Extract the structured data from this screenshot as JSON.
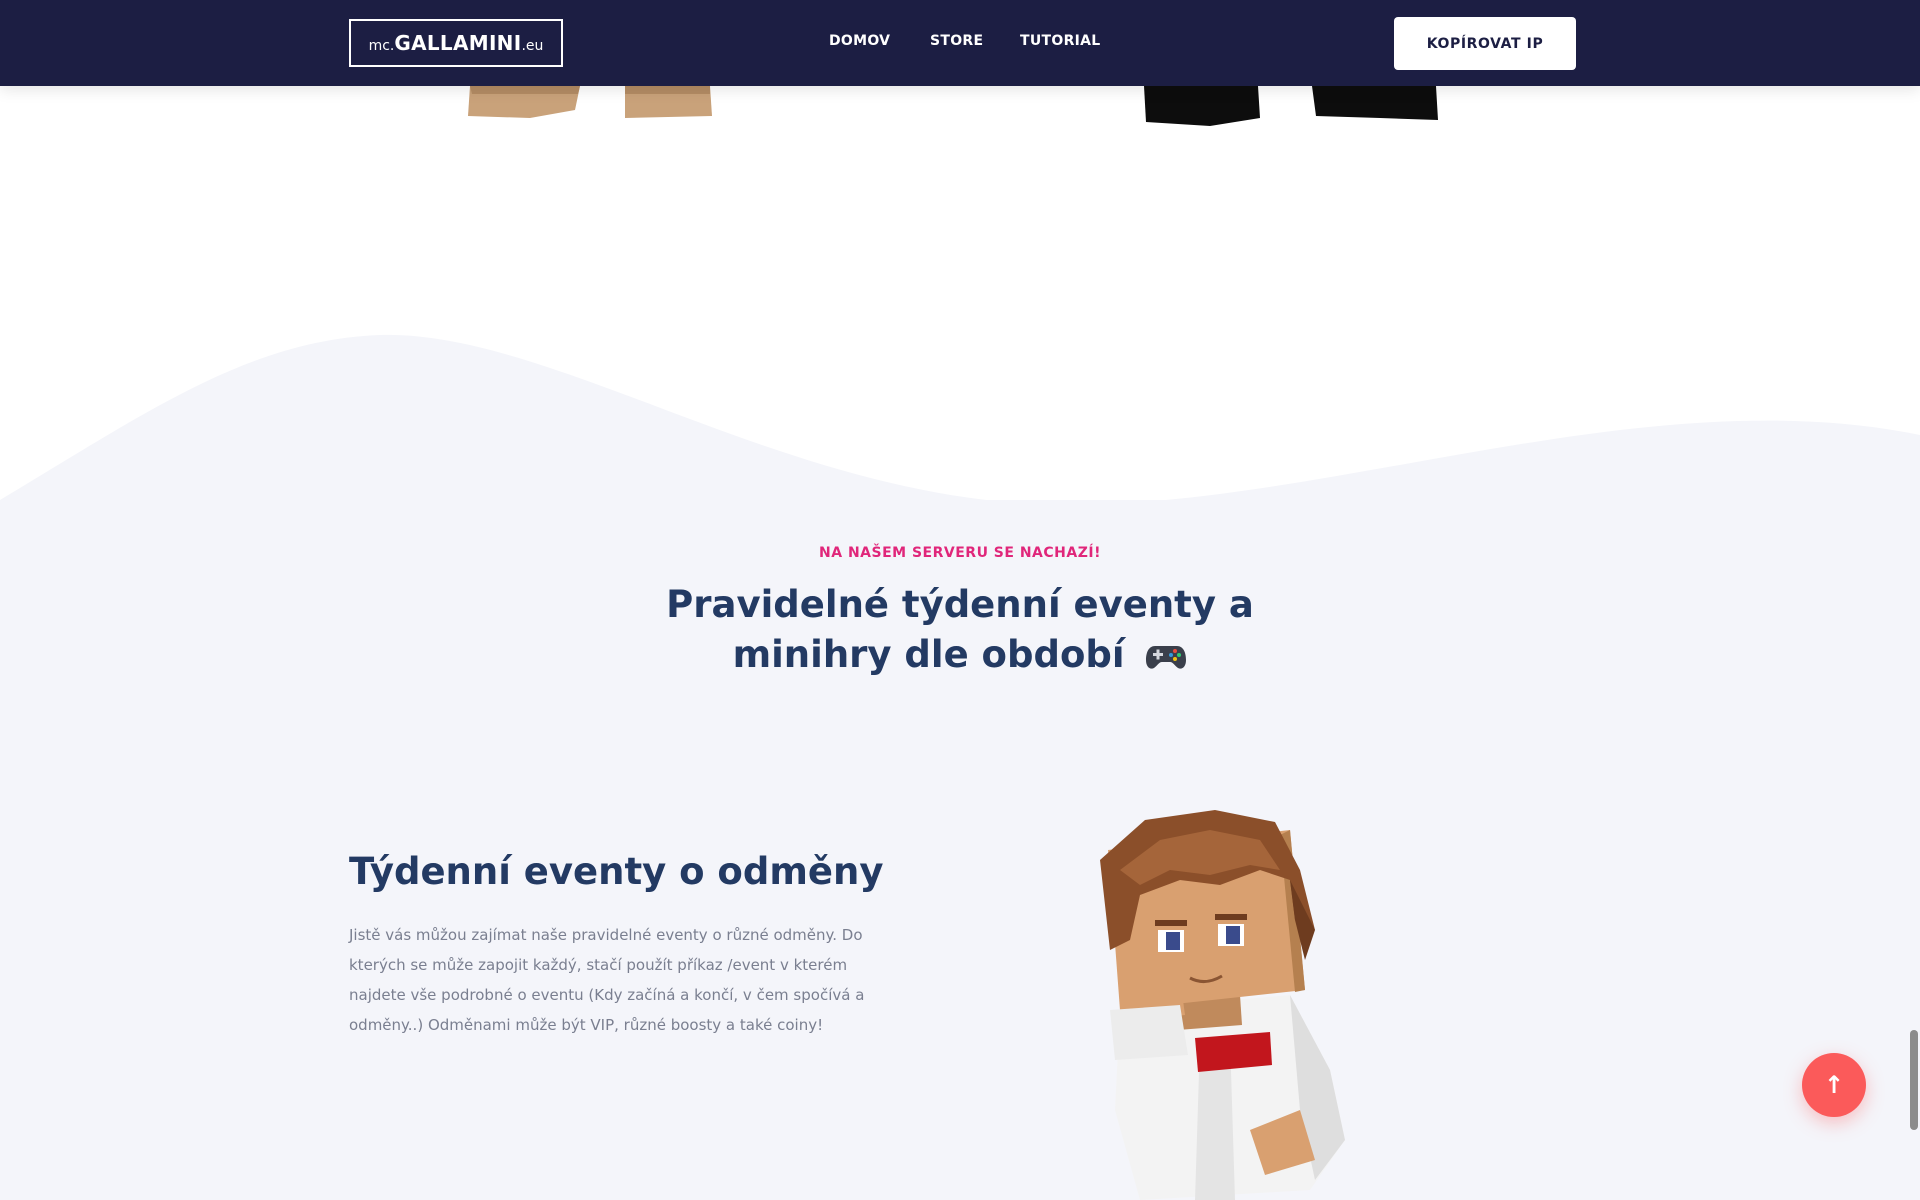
{
  "header": {
    "logo": {
      "prefix": "mc.",
      "main": "GALLAMINI",
      "suffix": ".eu"
    },
    "nav": [
      {
        "label": "DOMOV"
      },
      {
        "label": "STORE"
      },
      {
        "label": "TUTORIAL"
      }
    ],
    "copy_ip_label": "KOPÍROVAT IP"
  },
  "section": {
    "eyebrow": "NA NAŠEM SERVERU SE NACHAZÍ!",
    "title": "Pravidelné týdenní eventy a minihry dle období"
  },
  "feature": {
    "title": "Týdenní eventy o odměny",
    "text": "Jistě vás můžou zajímat naše pravidelné eventy o různé odměny. Do kterých se může zapojit každý, stačí použít příkaz /event v kterém najdete vše podrobné o eventu (Kdy začíná a končí, v čem spočívá a odměny..) Odměnami může být VIP, různé boosty a také coiny!"
  },
  "colors": {
    "header_bg": "#1c1e43",
    "accent_pink": "#e0267a",
    "title_blue": "#233a63",
    "scroll_top": "#fb5a5a",
    "section_bg": "#f4f5fa"
  },
  "icons": {
    "section_title_icon": "gamepad-icon",
    "scroll_top_icon": "arrow-up-icon"
  }
}
